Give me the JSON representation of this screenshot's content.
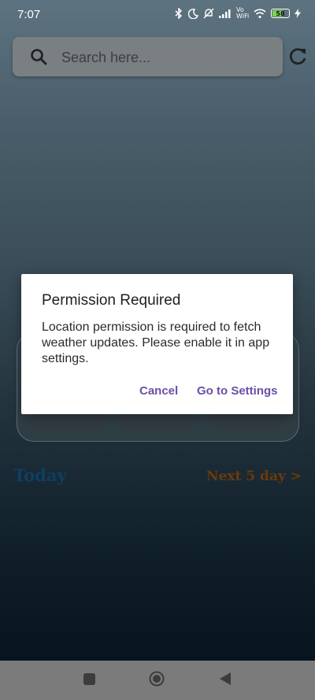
{
  "status_bar": {
    "time": "7:07",
    "network_label": "Vo WiFi",
    "battery_level": "58"
  },
  "search": {
    "placeholder": "Search here..."
  },
  "forecast_links": {
    "today_label": "Today",
    "next_days_label": "Next 5 day >"
  },
  "dialog": {
    "title": "Permission Required",
    "message": "Location permission is required to fetch weather updates. Please enable it in app settings.",
    "cancel_label": "Cancel",
    "settings_label": "Go to Settings"
  },
  "colors": {
    "accent": "#6a4fa8",
    "today": "#0d3f64",
    "next_days": "#6a3a0c"
  }
}
